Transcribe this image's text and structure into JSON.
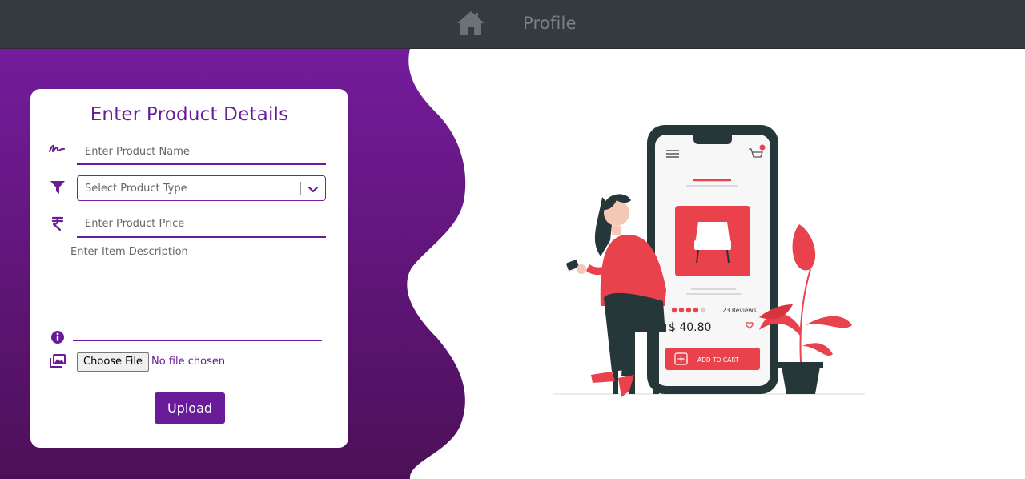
{
  "nav": {
    "home_icon": "home-icon",
    "profile_label": "Profile"
  },
  "form": {
    "title": "Enter Product Details",
    "name_placeholder": "Enter Product Name",
    "type_placeholder": "Select Product Type",
    "price_placeholder": "Enter Product Price",
    "description_placeholder": "Enter Item Description",
    "file_button_label": "Choose File",
    "file_status": "No file chosen",
    "upload_label": "Upload",
    "icons": [
      "signature-icon",
      "filter-icon",
      "rupee-icon",
      "info-icon",
      "images-icon"
    ]
  },
  "illustration": {
    "price": "$ 40.80",
    "reviews": "23 Reviews",
    "add_to_cart": "ADD TO CART"
  },
  "colors": {
    "navbar": "#343a40",
    "accent": "#6a1b9a",
    "product_red": "#e9424d"
  }
}
